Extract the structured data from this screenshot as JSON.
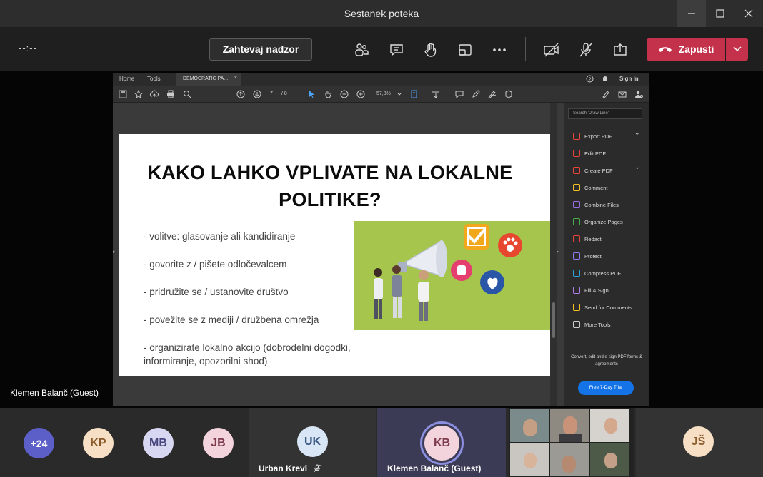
{
  "window": {
    "title": "Sestanek poteka"
  },
  "toolbar": {
    "timer": "--:--",
    "request_control_label": "Zahtevaj nadzor",
    "leave_label": "Zapusti",
    "icons": [
      "participants-icon",
      "chat-icon",
      "raise-hand-icon",
      "rooms-icon",
      "more-icon",
      "camera-off-icon",
      "mic-off-icon",
      "share-icon"
    ]
  },
  "stage": {
    "presenter_name": "Klemen Balanč (Guest)"
  },
  "acrobat": {
    "menu_home": "Home",
    "menu_tools": "Tools",
    "doc_tab": "DEMOCRATIC PA...",
    "doc_tab_close": "×",
    "sign_in": "Sign In",
    "page_current": "7",
    "page_total": "/ 8",
    "zoom": "57,8%",
    "search_placeholder": "Search 'Draw Line'",
    "tools": [
      {
        "label": "Export PDF",
        "color": "#e8443a",
        "expand": true
      },
      {
        "label": "Edit PDF",
        "color": "#e8443a",
        "expand": false
      },
      {
        "label": "Create PDF",
        "color": "#e8443a",
        "expand": true
      },
      {
        "label": "Comment",
        "color": "#f5c022",
        "expand": false
      },
      {
        "label": "Combine Files",
        "color": "#9c6ce8",
        "expand": false
      },
      {
        "label": "Organize Pages",
        "color": "#45b04a",
        "expand": false
      },
      {
        "label": "Redact",
        "color": "#e8443a",
        "expand": false
      },
      {
        "label": "Protect",
        "color": "#8a7ee8",
        "expand": false
      },
      {
        "label": "Compress PDF",
        "color": "#2fa3d8",
        "expand": false
      },
      {
        "label": "Fill & Sign",
        "color": "#b07cf0",
        "expand": false
      },
      {
        "label": "Send for Comments",
        "color": "#f5c022",
        "expand": false
      },
      {
        "label": "More Tools",
        "color": "#cccccc",
        "expand": false
      }
    ],
    "promo_text": "Convert, edit and e-sign PDF forms & agreements",
    "trial_button": "Free 7-Day Trial"
  },
  "slide": {
    "title_line1": "KAKO LAHKO VPLIVATE NA LOKALNE",
    "title_line2": "POLITIKE?",
    "bullets": [
      "- volitve: glasovanje ali kandidiranje",
      "- govorite z / pišete odločevalcem",
      "- pridružite se / ustanovite društvo",
      "- povežite se z mediji / družbena omrežja",
      "- organizirate lokalno akcijo (dobrodelni dogodki,",
      "informiranje, opozorilni shod)"
    ],
    "illustration_bg": "#a6c54d"
  },
  "participants": {
    "overflow": "+24",
    "avatars": [
      {
        "initials": "KP",
        "bg": "#f6dfc4",
        "fg": "#8a5a2b"
      },
      {
        "initials": "MB",
        "bg": "#d8d7f2",
        "fg": "#45467e"
      },
      {
        "initials": "JB",
        "bg": "#f3d4dc",
        "fg": "#7e3c4c"
      }
    ],
    "tile_urban": {
      "initials": "UK",
      "name": "Urban Krevl",
      "bg": "#d9e6f5",
      "fg": "#3b5b84"
    },
    "tile_klemen": {
      "initials": "KB",
      "name": "Klemen Balanč (Guest)",
      "bg": "#f3d4dc",
      "fg": "#7e3c4c"
    },
    "tile_js": {
      "initials": "JŠ",
      "bg": "#f6dfc4",
      "fg": "#8a5a2b"
    }
  }
}
